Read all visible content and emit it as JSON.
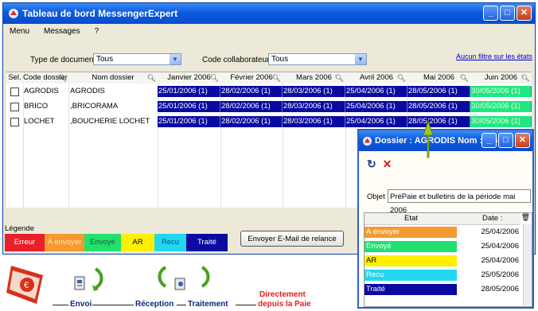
{
  "window": {
    "title": "Tableau de bord MessengerExpert"
  },
  "menu": {
    "items": [
      "Menu",
      "Messages",
      "?"
    ]
  },
  "filters": {
    "doc_type_label": "Type de document",
    "doc_type_value": "Tous",
    "collab_label": "Code collaborateur",
    "collab_value": "Tous",
    "no_filter_link": "Aucun filtre sur les états"
  },
  "table": {
    "headers": {
      "sel": "Sel.",
      "code": "Code dossier",
      "name": "Nom dossier",
      "months": [
        "Janvier 2006",
        "Février 2006",
        "Mars 2006",
        "Avril 2006",
        "Mai 2006",
        "Juin 2006"
      ]
    },
    "rows": [
      {
        "code": "AGRODIS",
        "name": "AGRODIS",
        "dates": [
          "25/01/2006 (1)",
          "28/02/2006 (1)",
          "28/03/2006 (1)",
          "25/04/2006 (1)",
          "28/05/2006 (1)",
          "30/05/2006 (1)"
        ]
      },
      {
        "code": "BRICO",
        "name": ",BRICORAMA",
        "dates": [
          "25/01/2006 (1)",
          "28/02/2006 (1)",
          "28/03/2006 (1)",
          "25/04/2006 (1)",
          "28/05/2006 (1)",
          "30/05/2006 (1)"
        ]
      },
      {
        "code": "LOCHET",
        "name": ",BOUCHERIE LOCHET",
        "dates": [
          "25/01/2006 (1)",
          "28/02/2006 (1)",
          "28/03/2006 (1)",
          "25/04/2006 (1)",
          "28/05/2006 (1)",
          "30/05/2006 (1)"
        ]
      }
    ]
  },
  "legend": {
    "title": "Légende",
    "items": [
      {
        "label": "Erreur",
        "color": "#e8202a",
        "text_color": "#ffffff"
      },
      {
        "label": "A envoyer",
        "color": "#f49a30",
        "text_color": "#ffe4c0"
      },
      {
        "label": "Envoyé",
        "color": "#20e070",
        "text_color": "#206030"
      },
      {
        "label": "AR",
        "color": "#fff000",
        "text_color": "#000000"
      },
      {
        "label": "Recu",
        "color": "#20d8f0",
        "text_color": "#0a4a80"
      },
      {
        "label": "Traité",
        "color": "#0a0aa0",
        "text_color": "#ffffff"
      }
    ]
  },
  "send_button": "Envoyer E-Mail de relance",
  "popup": {
    "title": "Dossier : AGRODIS Nom : AG...",
    "object_label": "Objet",
    "object_value": "PréPaie et bulletins de la période mai 2006",
    "col_state": "Etat",
    "col_date": "Date :",
    "rows": [
      {
        "state": "A envoyer",
        "date": "25/04/2006",
        "color": "#f49a30"
      },
      {
        "state": "Envoyé",
        "date": "25/04/2006",
        "color": "#20e070"
      },
      {
        "state": "AR",
        "date": "25/04/2006",
        "color": "#fff000"
      },
      {
        "state": "Recu",
        "date": "25/05/2006",
        "color": "#20d8f0"
      },
      {
        "state": "Traité",
        "date": "28/05/2006",
        "color": "#0a0aa0"
      }
    ]
  },
  "workflow": {
    "envoi": "Envoi",
    "reception": "Réception",
    "traitement": "Traitement",
    "directement": "Directement",
    "paie": "depuis la Paie"
  }
}
